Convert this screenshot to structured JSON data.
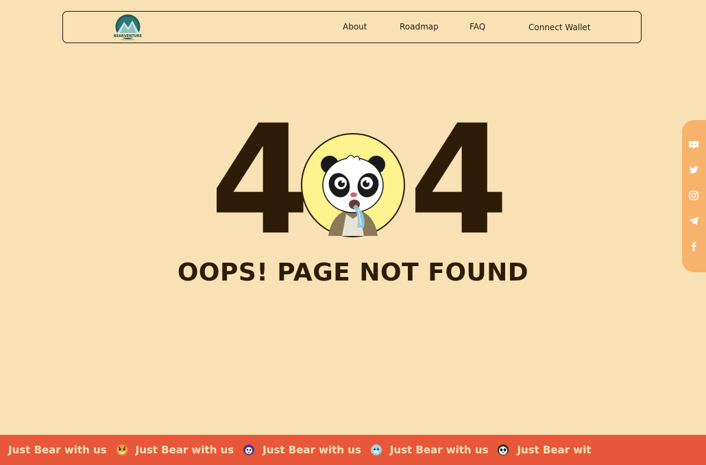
{
  "nav": {
    "logo_text": "BEARVENTURE",
    "about": "About",
    "roadmap": "Roadmap",
    "faq": "FAQ",
    "connect_wallet": "Connect Wallet"
  },
  "error": {
    "digit_left": "4",
    "digit_right": "4",
    "message": "OOPS! PAGE NOT FOUND"
  },
  "social": [
    "discord-icon",
    "twitter-icon",
    "instagram-icon",
    "telegram-icon",
    "facebook-icon"
  ],
  "marquee": {
    "items": [
      {
        "text": "Just Bear with us",
        "icon": "tiger-icon"
      },
      {
        "text": "Just Bear with us",
        "icon": "purple-bear-icon"
      },
      {
        "text": "Just Bear with us",
        "icon": "blue-bear-icon"
      },
      {
        "text": "Just Bear with us",
        "icon": "panda-icon"
      },
      {
        "text": "Just Bear wit",
        "icon": ""
      }
    ]
  },
  "colors": {
    "background": "#f8e2b5",
    "text": "#2e1c08",
    "marquee_bg": "#e8573a",
    "marquee_text": "#fbe3b8",
    "social_bg": "#f7b26c",
    "panda_circle": "#fef38e"
  }
}
